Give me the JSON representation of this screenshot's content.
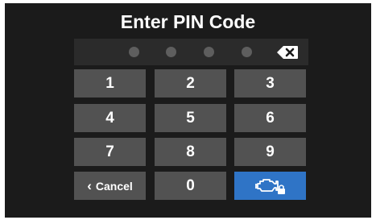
{
  "title": "Enter PIN Code",
  "pin": {
    "entered_count": 0,
    "dots": 4,
    "dot_color": "#5e5e5e"
  },
  "keypad": {
    "keys": [
      "1",
      "2",
      "3",
      "4",
      "5",
      "6",
      "7",
      "8",
      "9",
      "0"
    ],
    "cancel_label": "Cancel",
    "cancel_icon": "chevron-left-icon",
    "enter_icon": "engine-lock-icon",
    "backspace_icon": "backspace-icon"
  },
  "colors": {
    "background": "#1b1b1b",
    "key": "#525252",
    "pin_bar": "#2b2b2b",
    "accent": "#2f74c6"
  }
}
